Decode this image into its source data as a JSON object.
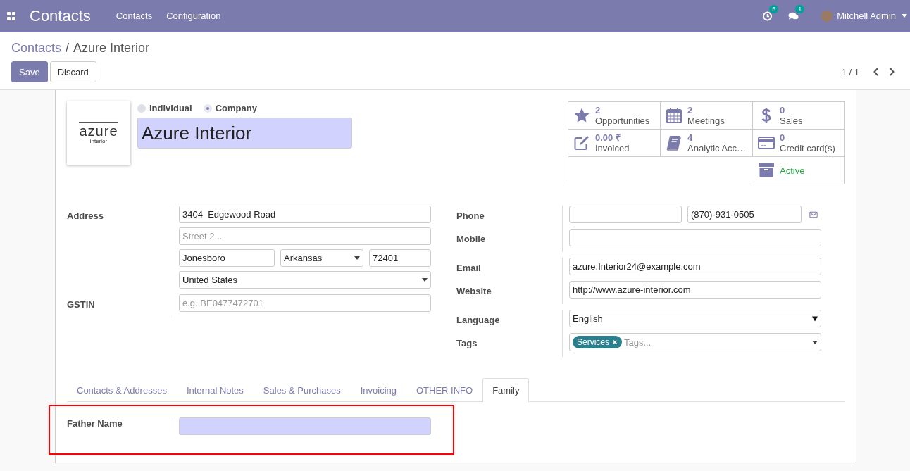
{
  "navbar": {
    "app_title": "Contacts",
    "menu": [
      "Contacts",
      "Configuration"
    ],
    "activity_count": "5",
    "message_count": "1",
    "user": "Mitchell Admin"
  },
  "breadcrumb": {
    "parent": "Contacts",
    "separator": "/",
    "current": "Azure Interior"
  },
  "actions": {
    "save": "Save",
    "discard": "Discard"
  },
  "pager": "1 / 1",
  "logo": {
    "word": "azure",
    "sub": "interior"
  },
  "company_type": [
    {
      "label": "Individual",
      "selected": false
    },
    {
      "label": "Company",
      "selected": true
    }
  ],
  "name": {
    "value": "Azure Interior",
    "required": true
  },
  "stat_buttons": [
    {
      "kind": "stat",
      "value": "2",
      "label": "Opportunities"
    },
    {
      "kind": "stat",
      "value": "2",
      "label": "Meetings"
    },
    {
      "kind": "stat",
      "value": "0",
      "label": "Sales"
    },
    {
      "kind": "stat",
      "value": "0.00 ₹",
      "label": "Invoiced"
    },
    {
      "kind": "stat",
      "value": "4",
      "label": "Analytic Acc…"
    },
    {
      "kind": "stat",
      "value": "0",
      "label": "Credit card(s)"
    },
    {
      "kind": "toggle",
      "label": "Active",
      "on": true
    }
  ],
  "left_group": [
    {
      "label": "Address",
      "lines": [
        [
          {
            "kind": "input",
            "value": "3404  Edgewood Road"
          }
        ],
        [
          {
            "kind": "input",
            "placeholder": "Street 2..."
          }
        ],
        [
          {
            "kind": "input",
            "value": "Jonesboro"
          },
          {
            "kind": "select",
            "value": "Arkansas"
          },
          {
            "kind": "input",
            "value": "72401"
          }
        ],
        [
          {
            "kind": "select",
            "value": "United States"
          }
        ]
      ]
    },
    {
      "label": "GSTIN",
      "lines": [
        [
          {
            "kind": "input",
            "placeholder": "e.g. BE0477472701"
          }
        ]
      ]
    }
  ],
  "right_group": [
    {
      "label": "Phone",
      "lines": [
        [
          {
            "kind": "input"
          },
          {
            "kind": "input",
            "value": "(870)-931-0505"
          },
          {
            "kind": "mail"
          }
        ]
      ]
    },
    {
      "label": "Mobile",
      "lines": [
        [
          {
            "kind": "input"
          }
        ]
      ]
    },
    {
      "label": "Email",
      "lines": [
        [
          {
            "kind": "input",
            "value": "azure.Interior24@example.com"
          }
        ]
      ]
    },
    {
      "label": "Website",
      "lines": [
        [
          {
            "kind": "input",
            "value": "http://www.azure-interior.com"
          }
        ]
      ]
    },
    {
      "label": "Language",
      "lines": [
        [
          {
            "kind": "native-select",
            "value": "English"
          }
        ]
      ]
    },
    {
      "label": "Tags",
      "lines": [
        [
          {
            "kind": "tags",
            "tags": [
              "Services"
            ],
            "placeholder": "Tags..."
          }
        ]
      ]
    }
  ],
  "tabs": [
    {
      "label": "Contacts & Addresses",
      "selected": false
    },
    {
      "label": "Internal Notes",
      "selected": false
    },
    {
      "label": "Sales & Purchases",
      "selected": false
    },
    {
      "label": "Invoicing",
      "selected": false
    },
    {
      "label": "OTHER INFO",
      "selected": false
    },
    {
      "label": "Family",
      "selected": true
    }
  ],
  "family_fields": [
    {
      "label": "Father Name",
      "required": true
    }
  ]
}
